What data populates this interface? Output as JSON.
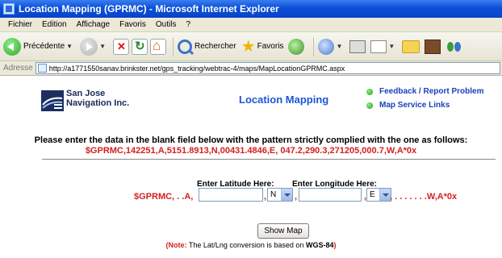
{
  "window": {
    "title": "Location Mapping (GPRMC) - Microsoft Internet Explorer"
  },
  "menu": [
    "Fichier",
    "Edition",
    "Affichage",
    "Favoris",
    "Outils",
    "?"
  ],
  "toolbar": {
    "back_label": "Précédente",
    "search_label": "Rechercher",
    "favorites_label": "Favoris"
  },
  "address": {
    "label": "Adresse",
    "url": "http://a1771550sanav.brinkster.net/gps_tracking/webtrac-4/maps/MapLocationGPRMC.aspx"
  },
  "header": {
    "company_line1": "San Jose",
    "company_line2": "Navigation Inc.",
    "page_title": "Location Mapping",
    "links": [
      "Feedback / Report Problem",
      "Map Service Links"
    ]
  },
  "instructions": {
    "line1": "Please enter the data in the blank field below with the pattern strictly complied with the one as follows:",
    "example": "$GPRMC,142251,A,5151.8913,N,00431.4846,E, 047.2,290.3,271205,000.7,W,A*0x"
  },
  "form": {
    "lat_label": "Enter Latitude Here:",
    "lng_label": "Enter Longitude Here:",
    "prefix": "$GPRMC, . .A,",
    "lat_value": "",
    "ns_selected": "N",
    "lng_value": "",
    "ew_selected": "E",
    "comma": ",",
    "suffix": ", . . . . . . .W,A*0x",
    "show_button": "Show Map"
  },
  "note": {
    "open": "(",
    "note_label": "Note:",
    "text": " The Lat/Lng conversion is based on ",
    "datum": "WGS-84",
    "close": ")"
  }
}
